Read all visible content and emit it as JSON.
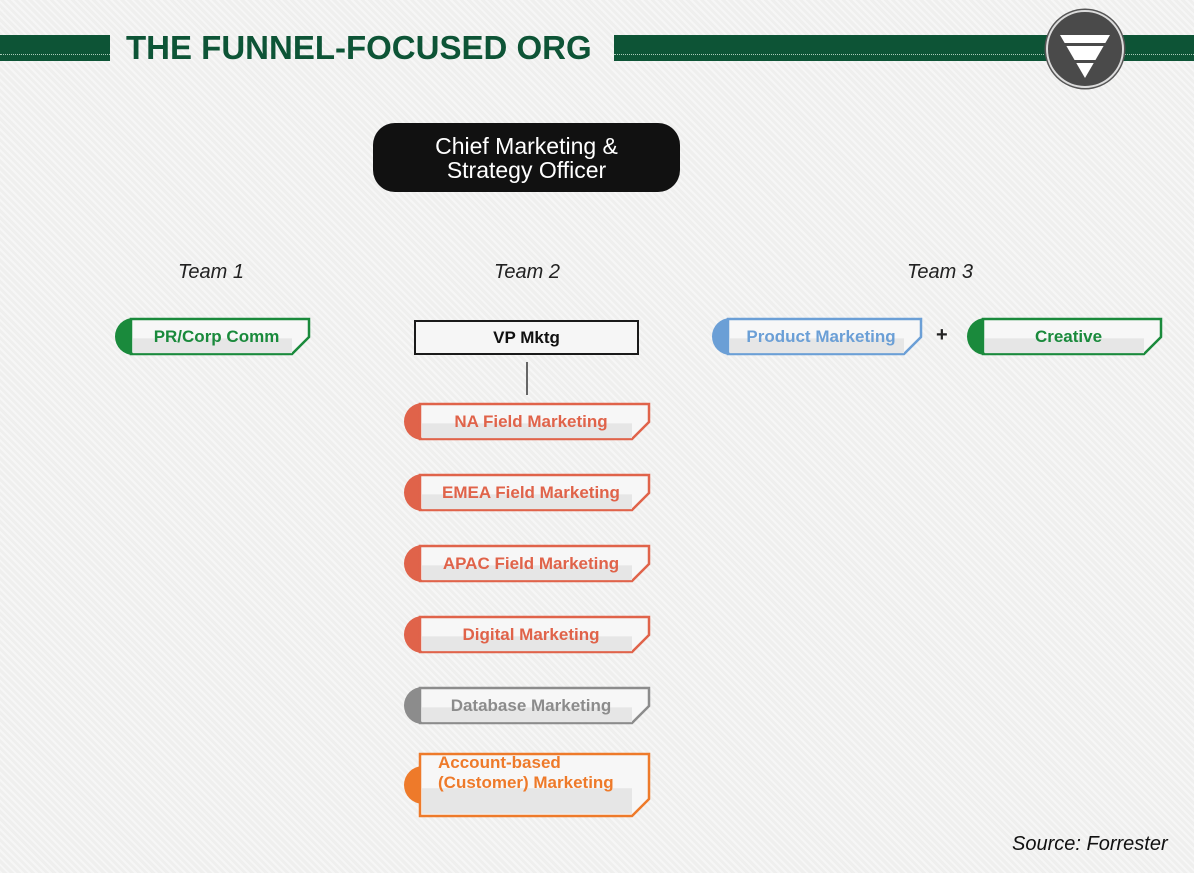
{
  "header": {
    "title": "THE FUNNEL-FOCUSED ORG",
    "logo_icon": "funnel-icon",
    "brand_color": "#0d5436"
  },
  "root": {
    "line1": "Chief Marketing &",
    "line2": "Strategy Officer"
  },
  "teams": [
    {
      "label": "Team 1"
    },
    {
      "label": "Team 2"
    },
    {
      "label": "Team 3"
    }
  ],
  "team1": {
    "nodes": [
      {
        "label": "PR/Corp Comm",
        "color": "#1a8a3c"
      }
    ]
  },
  "team2": {
    "head": "VP Mktg",
    "nodes": [
      {
        "label": "NA Field Marketing",
        "color": "#e0634a"
      },
      {
        "label": "EMEA Field Marketing",
        "color": "#e0634a"
      },
      {
        "label": "APAC Field Marketing",
        "color": "#e0634a"
      },
      {
        "label": "Digital Marketing",
        "color": "#e0634a"
      },
      {
        "label": "Database Marketing",
        "color": "#8c8c8c"
      },
      {
        "label": "Account-based (Customer) Marketing",
        "line1": "Account-based",
        "line2": "(Customer) Marketing",
        "color": "#ee7a2a"
      }
    ]
  },
  "team3": {
    "nodes": [
      {
        "label": "Product Marketing",
        "color": "#6b9fd6"
      },
      {
        "label": "Creative",
        "color": "#1a8a3c"
      }
    ],
    "joiner": "+"
  },
  "footer": {
    "source": "Source: Forrester"
  }
}
